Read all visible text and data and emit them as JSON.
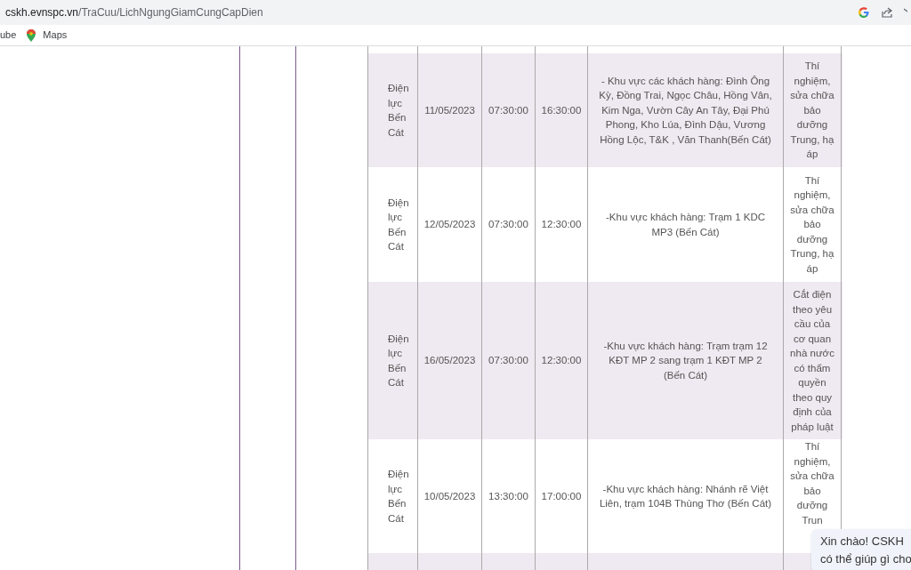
{
  "browser": {
    "url_domain": "cskh.evnspc.vn",
    "url_path": "/TraCuu/LichNgungGiamCungCapDien",
    "bookmarks": [
      {
        "label": "ube",
        "kind": "video"
      },
      {
        "label": "Maps",
        "kind": "maps"
      }
    ]
  },
  "table": {
    "rows": [
      {
        "unit": "Điện lực Bến Cát",
        "date": "11/05/2023",
        "start": "07:30:00",
        "end": "16:30:00",
        "area": "- Khu vực các khách hàng: Đình Ông Kỳ, Đồng Trai, Ngọc Châu, Hồng Vân, Kim Nga, Vườn Cây An Tây, Đại Phú Phong, Kho Lúa, Đình Dậu, Vương Hồng Lộc, T&K , Văn Thanh(Bến Cát)",
        "reason": "Thí nghiệm, sửa chữa bảo dưỡng Trung, hạ áp"
      },
      {
        "unit": "Điện lực Bến Cát",
        "date": "12/05/2023",
        "start": "07:30:00",
        "end": "12:30:00",
        "area": "-Khu vực khách hàng: Trạm 1 KDC MP3 (Bến Cát)",
        "reason": "Thí nghiệm, sửa chữa bảo dưỡng Trung, hạ áp"
      },
      {
        "unit": "Điện lực Bến Cát",
        "date": "16/05/2023",
        "start": "07:30:00",
        "end": "12:30:00",
        "area": "-Khu vực khách hàng: Trạm trạm 12 KĐT MP 2 sang trạm 1 KĐT MP 2 (Bến Cát)",
        "reason": "Cắt điện theo yêu cầu của cơ quan nhà nước có thẩm quyền theo quy định của pháp luật"
      },
      {
        "unit": "Điện lực Bến Cát",
        "date": "10/05/2023",
        "start": "13:30:00",
        "end": "17:00:00",
        "area": "-Khu vực khách hàng: Nhánh rẽ Việt Liên, trạm 104B Thùng Thơ (Bến Cát)",
        "reason": "Thí nghiệm, sửa chữa bảo dưỡng Trun"
      }
    ]
  },
  "chat_popup": {
    "lines": [
      "Xin chào! CSKH",
      "có thể giúp gì cho"
    ]
  }
}
